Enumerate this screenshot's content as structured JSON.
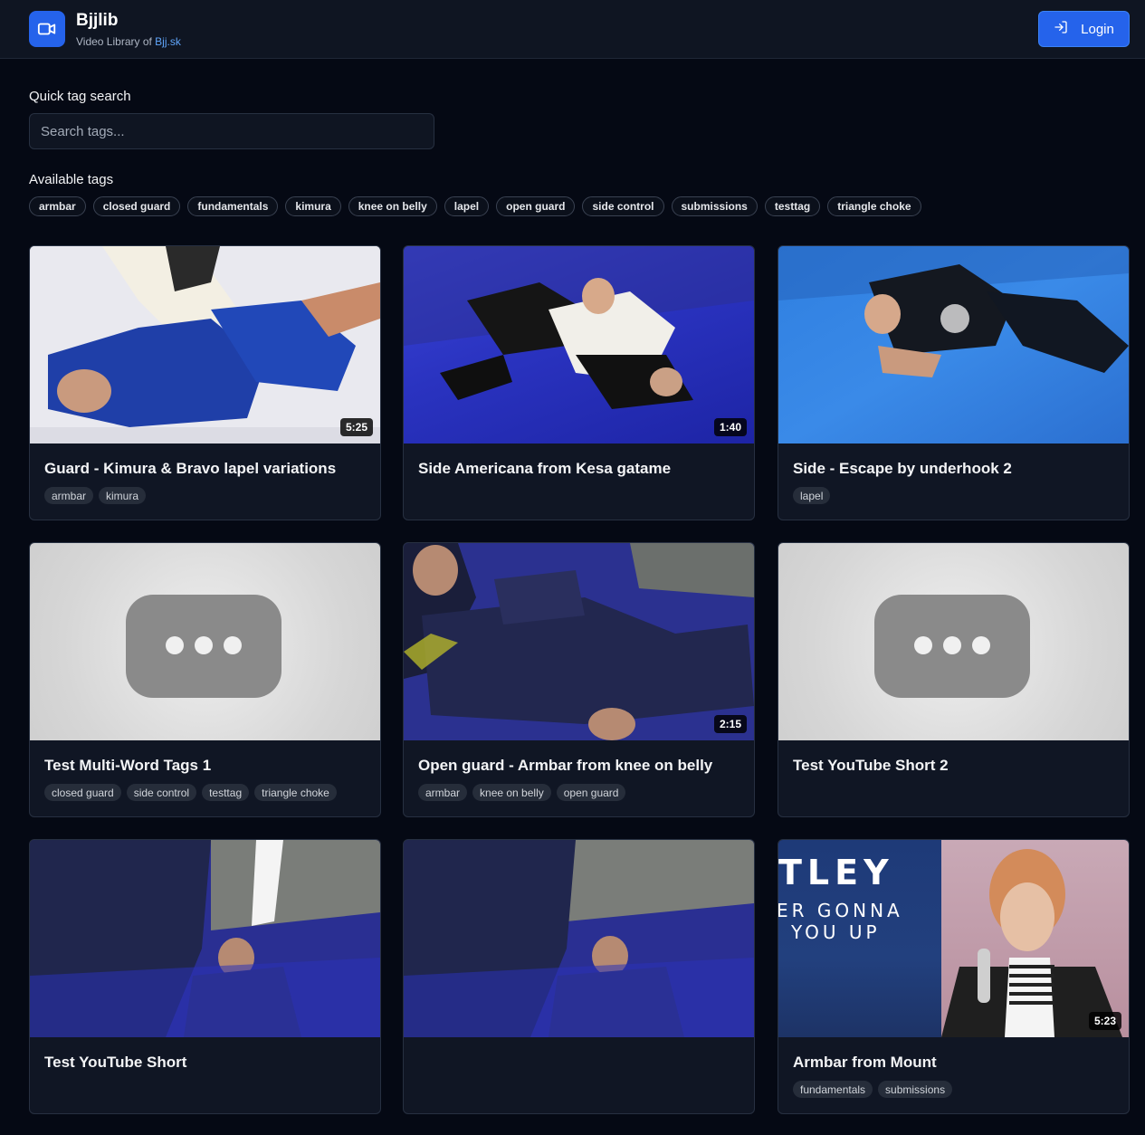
{
  "header": {
    "app_name": "Bjjlib",
    "subtitle_prefix": "Video Library of ",
    "subtitle_link": "Bjj.sk",
    "login_label": "Login"
  },
  "search": {
    "label": "Quick tag search",
    "placeholder": "Search tags...",
    "value": ""
  },
  "available_tags": {
    "label": "Available tags",
    "items": [
      "armbar",
      "closed guard",
      "fundamentals",
      "kimura",
      "knee on belly",
      "lapel",
      "open guard",
      "side control",
      "submissions",
      "testtag",
      "triangle choke"
    ]
  },
  "videos": [
    {
      "title": "Guard - Kimura & Bravo lapel variations",
      "duration": "5:25",
      "tags": [
        "armbar",
        "kimura"
      ]
    },
    {
      "title": "Side Americana from Kesa gatame",
      "duration": "1:40",
      "tags": []
    },
    {
      "title": "Side - Escape by underhook 2",
      "duration": "",
      "tags": [
        "lapel"
      ]
    },
    {
      "title": "Test Multi-Word Tags 1",
      "duration": "",
      "tags": [
        "closed guard",
        "side control",
        "testtag",
        "triangle choke"
      ]
    },
    {
      "title": "Open guard - Armbar from knee on belly",
      "duration": "2:15",
      "tags": [
        "armbar",
        "knee on belly",
        "open guard"
      ]
    },
    {
      "title": "Test YouTube Short 2",
      "duration": "",
      "tags": []
    },
    {
      "title": "Test YouTube Short",
      "duration": "",
      "tags": []
    },
    {
      "title": "",
      "duration": "",
      "tags": []
    },
    {
      "title": "Armbar from Mount",
      "duration": "5:23",
      "tags": [
        "fundamentals",
        "submissions"
      ]
    }
  ],
  "thumb_text": {
    "line1": "TLEY",
    "line2": "ER GONNA",
    "line3": "YOU UP"
  },
  "colors": {
    "background": "#050914",
    "header_bg": "#0f1522",
    "accent": "#2563eb",
    "link": "#60a5fa",
    "card_bg": "#101624"
  },
  "icons": {
    "logo": "video-camera-icon",
    "login": "login-arrow-icon",
    "placeholder": "youtube-placeholder-icon"
  }
}
